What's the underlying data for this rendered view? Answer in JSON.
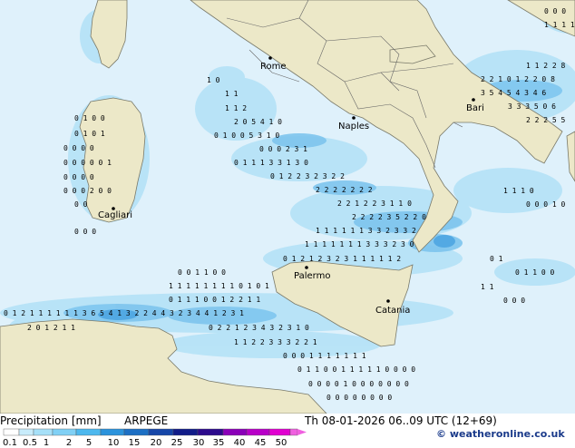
{
  "map": {
    "cities": [
      {
        "name": "Rome"
      },
      {
        "name": "Naples"
      },
      {
        "name": "Bari"
      },
      {
        "name": "Cagliari"
      },
      {
        "name": "Palermo"
      },
      {
        "name": "Catania"
      }
    ],
    "colors": {
      "sea": "#dff1fb",
      "land": "#ece8c8",
      "light_precip": "#b6e3f7",
      "mid_precip": "#7ec5ee",
      "heavy_precip": "#4aa3e0",
      "border": "#555555"
    }
  },
  "footer": {
    "product": "Precipitation [mm]",
    "model": "ARPEGE",
    "valid_time": "Th 08-01-2026 06..09 UTC (12+69)",
    "credit": "© weatheronline.co.uk",
    "scale": {
      "labels": [
        "0.1",
        "0.5",
        "1",
        "2",
        "5",
        "10",
        "15",
        "20",
        "25",
        "30",
        "35",
        "40",
        "45",
        "50"
      ],
      "colors": [
        "#ffffff",
        "#c8ecfb",
        "#a6e0f8",
        "#80d0f5",
        "#4db8ee",
        "#2b93dc",
        "#1c6fc4",
        "#1646a8",
        "#111c88",
        "#2c0a8c",
        "#8a00b8",
        "#b800c8",
        "#e000d0",
        "#f060e0"
      ]
    }
  }
}
